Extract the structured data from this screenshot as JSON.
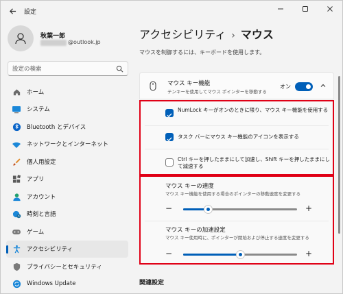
{
  "window": {
    "title": "設定"
  },
  "profile": {
    "name": "秋葉一郎",
    "email_suffix": "@outlook.jp"
  },
  "search": {
    "placeholder": "設定の検索"
  },
  "nav": [
    {
      "label": "ホーム",
      "icon": "home-icon",
      "active": false
    },
    {
      "label": "システム",
      "icon": "monitor-icon",
      "active": false
    },
    {
      "label": "Bluetooth とデバイス",
      "icon": "bluetooth-icon",
      "active": false
    },
    {
      "label": "ネットワークとインターネット",
      "icon": "wifi-icon",
      "active": false
    },
    {
      "label": "個人用設定",
      "icon": "brush-icon",
      "active": false
    },
    {
      "label": "アプリ",
      "icon": "apps-icon",
      "active": false
    },
    {
      "label": "アカウント",
      "icon": "account-icon",
      "active": false
    },
    {
      "label": "時刻と言語",
      "icon": "globe-clock-icon",
      "active": false
    },
    {
      "label": "ゲーム",
      "icon": "gamepad-icon",
      "active": false
    },
    {
      "label": "アクセシビリティ",
      "icon": "accessibility-icon",
      "active": true
    },
    {
      "label": "プライバシーとセキュリティ",
      "icon": "shield-icon",
      "active": false
    },
    {
      "label": "Windows Update",
      "icon": "update-icon",
      "active": false
    }
  ],
  "breadcrumb": {
    "parent": "アクセシビリティ",
    "separator": "›",
    "current": "マウス"
  },
  "page": {
    "description": "マウスを制御するには、キーボードを使用します。"
  },
  "mouse_keys": {
    "title": "マウス キー機能",
    "subtitle": "テンキーを使用してマウス ポインターを移動する",
    "toggle_label": "オン",
    "toggle_on": true
  },
  "options": [
    {
      "label": "NumLock キーがオンのときに限り、マウス キー機能を使用する",
      "checked": true
    },
    {
      "label": "タスク バーにマウス キー機能のアイコンを表示する",
      "checked": true
    },
    {
      "label": "Ctrl キーを押したままにして加速し、Shift キーを押したままにして減速する",
      "checked": false
    }
  ],
  "sliders": [
    {
      "title": "マウス キーの速度",
      "subtitle": "マウス キー機能を使用する場合のポインターの移動速度を変更する",
      "value": 0.22
    },
    {
      "title": "マウス キーの加速設定",
      "subtitle": "マウス キー使用時に、ポインターが開始および停止する速度を変更する",
      "value": 0.5
    }
  ],
  "slider_labels": {
    "minus": "−",
    "plus": "+"
  },
  "related": {
    "title": "関連設定"
  },
  "colors": {
    "accent": "#005fb8",
    "highlight": "#e00016"
  }
}
